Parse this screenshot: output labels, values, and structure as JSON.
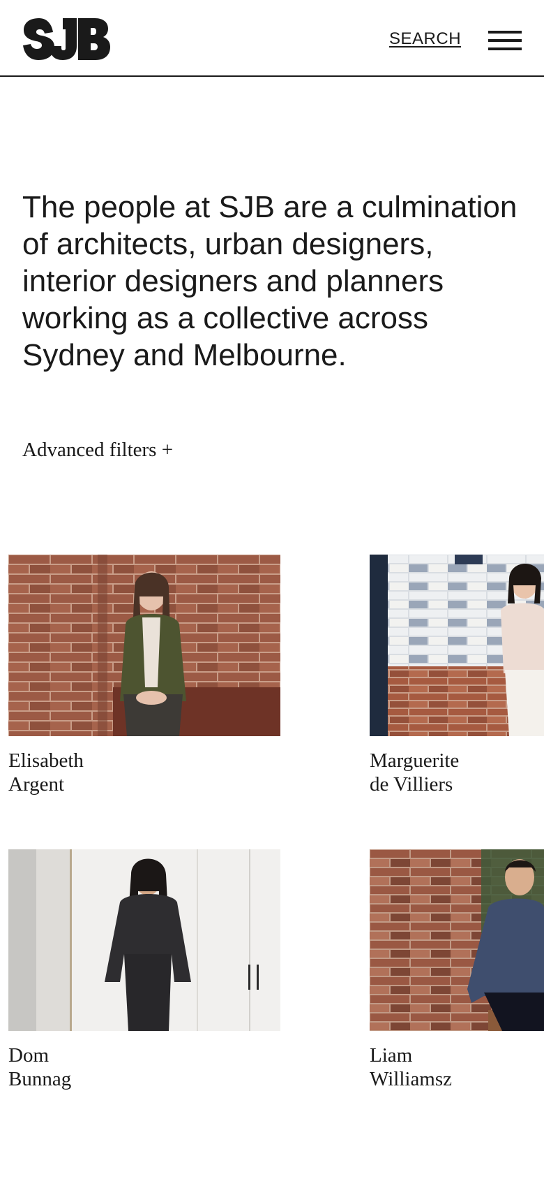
{
  "header": {
    "logo_text": "SJB",
    "search_label": "SEARCH"
  },
  "intro": {
    "text": "The people at SJB are a culmination of architects, urban designers, interior designers and planners working as a collective across Sydney and Melbourne."
  },
  "filters": {
    "label": "Advanced filters +"
  },
  "people": [
    {
      "first": "Elisabeth",
      "last": "Argent"
    },
    {
      "first": "Marguerite",
      "last": "de Villiers"
    },
    {
      "first": "Dom",
      "last": "Bunnag"
    },
    {
      "first": "Liam",
      "last": "Williamsz"
    }
  ],
  "colors": {
    "text": "#1a1a1a",
    "background": "#ffffff",
    "brick": "#9c5a45",
    "mortar": "#c99d88"
  }
}
